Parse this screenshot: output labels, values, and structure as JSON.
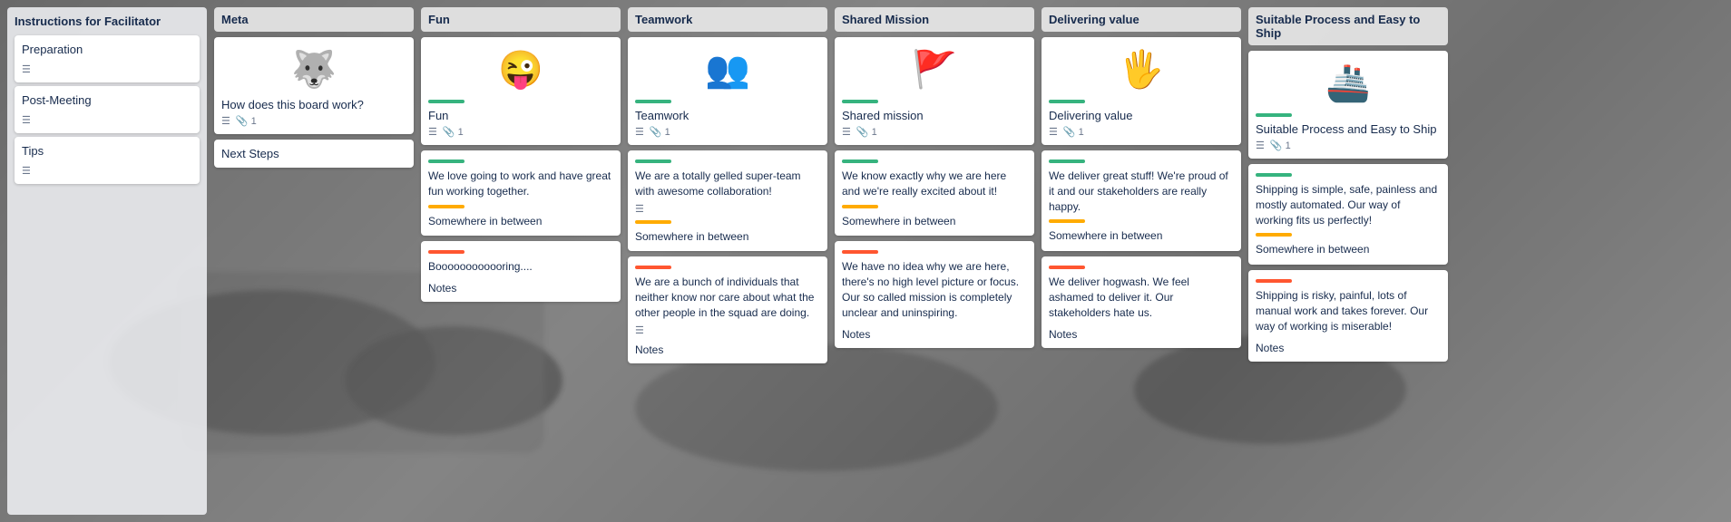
{
  "sidebar": {
    "header": "Instructions for Facilitator",
    "items": [
      {
        "id": "preparation",
        "title": "Preparation",
        "icon": "☰"
      },
      {
        "id": "post-meeting",
        "title": "Post-Meeting",
        "icon": "☰"
      },
      {
        "id": "tips",
        "title": "Tips",
        "icon": "☰"
      }
    ]
  },
  "columns": [
    {
      "id": "meta",
      "header": "Meta",
      "cards": [
        {
          "id": "meta-how",
          "emoji": "🐺",
          "text": "How does this board work?",
          "meta_icon": "☰",
          "attachment": "📎 1"
        },
        {
          "id": "meta-next",
          "title": "Next Steps",
          "no_icon": true
        }
      ]
    },
    {
      "id": "fun",
      "header": "Fun",
      "cards": [
        {
          "id": "fun-top",
          "emoji": "😜",
          "title": "Fun",
          "green_bar": true,
          "meta_icon": "☰",
          "attachment": "📎 1"
        },
        {
          "id": "fun-great",
          "green_bar": true,
          "text": "We love going to work and have great fun working together.",
          "label_bar": "yellow",
          "label": "Somewhere in between"
        },
        {
          "id": "fun-boring",
          "red_bar": true,
          "text": "Boooooooooooring....",
          "notes": "Notes"
        }
      ]
    },
    {
      "id": "teamwork",
      "header": "Teamwork",
      "cards": [
        {
          "id": "teamwork-top",
          "emoji": "👥",
          "title": "Teamwork",
          "green_bar": true,
          "meta_icon": "☰",
          "attachment": "📎 1"
        },
        {
          "id": "teamwork-great",
          "green_bar": true,
          "text": "We are a totally gelled super-team with awesome collaboration!",
          "meta_icon": "☰",
          "label_bar": "yellow",
          "label": "Somewhere in between"
        },
        {
          "id": "teamwork-bad",
          "red_bar": true,
          "text": "We are a bunch of individuals that neither know nor care about what the other people in the squad are doing.",
          "meta_icon": "☰",
          "notes": "Notes"
        }
      ]
    },
    {
      "id": "shared-mission",
      "header": "Shared Mission",
      "cards": [
        {
          "id": "sm-top",
          "emoji": "🚩",
          "title": "Shared mission",
          "green_bar": true,
          "meta_icon": "☰",
          "attachment": "📎 1"
        },
        {
          "id": "sm-great",
          "green_bar": true,
          "text": "We know exactly why we are here and we're really excited about it!",
          "label_bar": "yellow",
          "label": "Somewhere in between"
        },
        {
          "id": "sm-bad",
          "red_bar": true,
          "text": "We have no idea why we are here, there's no high level picture or focus. Our so called mission is completely unclear and uninspiring.",
          "notes": "Notes"
        }
      ]
    },
    {
      "id": "delivering-value",
      "header": "Delivering value",
      "cards": [
        {
          "id": "dv-top",
          "emoji": "🖐️",
          "title": "Delivering value",
          "green_bar": true,
          "meta_icon": "☰",
          "attachment": "📎 1"
        },
        {
          "id": "dv-great",
          "green_bar": true,
          "text": "We deliver great stuff! We're proud of it and our stakeholders are really happy.",
          "label_bar": "yellow",
          "label": "Somewhere in between"
        },
        {
          "id": "dv-bad",
          "red_bar": true,
          "text": "We deliver hogwash. We feel ashamed to deliver it. Our stakeholders hate us.",
          "notes": "Notes"
        }
      ]
    },
    {
      "id": "suitable-process",
      "header": "Suitable Process and Easy to Ship",
      "cards": [
        {
          "id": "sp-top",
          "emoji": "🚢",
          "title": "Suitable Process and Easy to Ship",
          "green_bar": true,
          "meta_icon": "☰",
          "attachment": "📎 1"
        },
        {
          "id": "sp-great",
          "green_bar": true,
          "text": "Shipping is simple, safe, painless and mostly automated. Our way of working fits us perfectly!",
          "label_bar": "yellow",
          "label": "Somewhere in between"
        },
        {
          "id": "sp-bad",
          "red_bar": true,
          "text": "Shipping is risky, painful, lots of manual work and takes forever. Our way of working is miserable!",
          "notes": "Notes"
        }
      ]
    }
  ],
  "colors": {
    "green": "#36b37e",
    "yellow": "#ffab00",
    "red": "#ff5630",
    "card_bg": "#ffffff",
    "header_bg": "rgba(235,236,240,0.9)"
  }
}
